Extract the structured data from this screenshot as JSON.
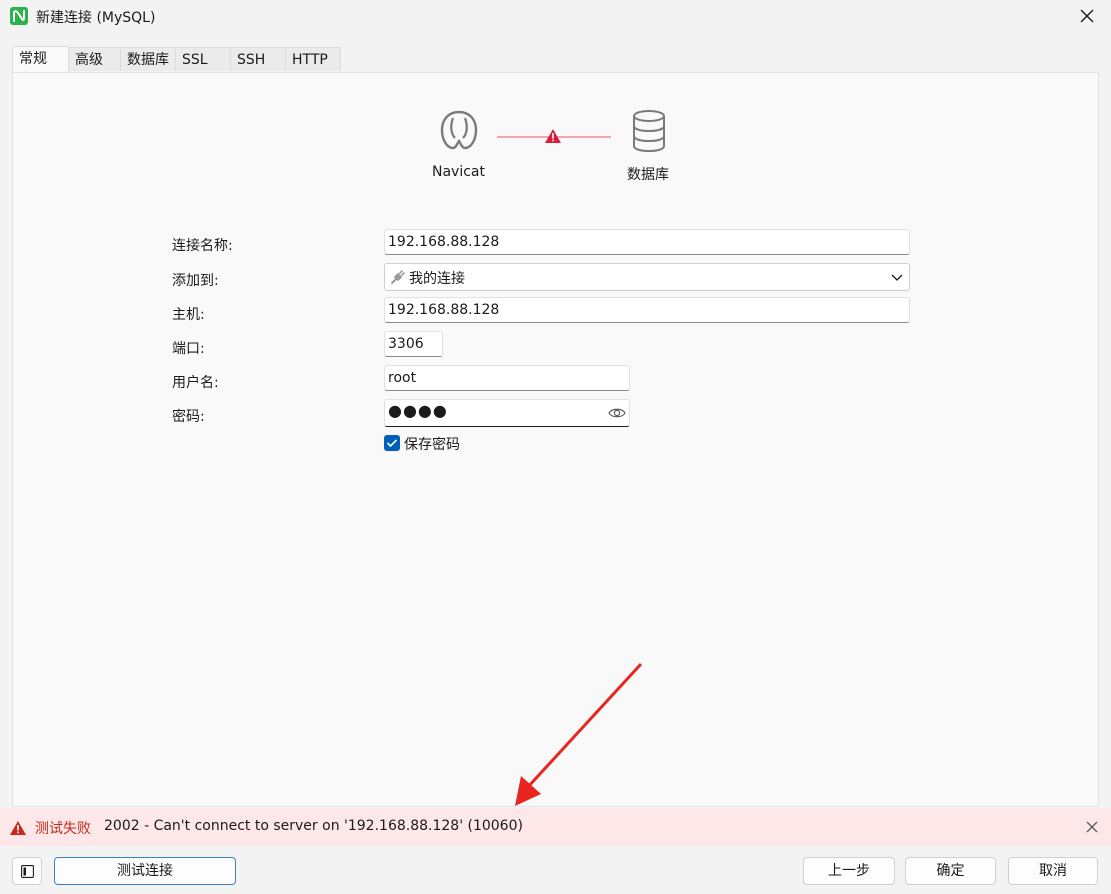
{
  "window": {
    "title": "新建连接 (MySQL)"
  },
  "tabs": [
    {
      "label": "常规",
      "active": true
    },
    {
      "label": "高级",
      "active": false
    },
    {
      "label": "数据库",
      "active": false
    },
    {
      "label": "SSL",
      "active": false
    },
    {
      "label": "SSH",
      "active": false
    },
    {
      "label": "HTTP",
      "active": false
    }
  ],
  "diagram": {
    "client_label": "Navicat",
    "server_label": "数据库",
    "status": "error"
  },
  "form": {
    "connection_name": {
      "label": "连接名称:",
      "value": "192.168.88.128"
    },
    "add_to": {
      "label": "添加到:",
      "value": "我的连接"
    },
    "host": {
      "label": "主机:",
      "value": "192.168.88.128"
    },
    "port": {
      "label": "端口:",
      "value": "3306"
    },
    "username": {
      "label": "用户名:",
      "value": "root"
    },
    "password": {
      "label": "密码:",
      "masked": "●●●●"
    },
    "save_password": {
      "label": "保存密码",
      "checked": true
    }
  },
  "error": {
    "title": "测试失败",
    "message": "2002 - Can't connect to server on '192.168.88.128' (10060)"
  },
  "buttons": {
    "test_connection": "测试连接",
    "previous": "上一步",
    "ok": "确定",
    "cancel": "取消"
  },
  "colors": {
    "accent": "#005fb8",
    "error_bg": "#fde7e9",
    "error_text": "#c42b1c",
    "annotation_arrow": "#e8261f"
  },
  "icons": {
    "app": "navicat-app-icon",
    "close": "close-icon",
    "client": "navicat-icon",
    "warning": "warning-icon",
    "server": "database-icon",
    "plug": "plug-icon",
    "dropdown": "chevron-down-icon",
    "reveal": "eye-icon",
    "sidebar": "sidebar-toggle-icon"
  }
}
